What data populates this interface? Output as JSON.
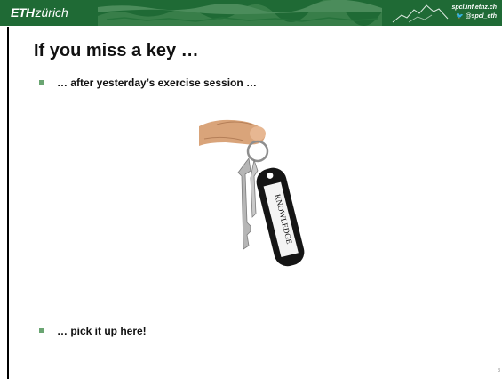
{
  "header": {
    "logo_eth": "ETH",
    "logo_zurich": "zürich",
    "site": "spcl.inf.ethz.ch",
    "twitter": "@spcl_eth",
    "bar_color": "#1f6a35"
  },
  "slide": {
    "title": "If you miss a key …",
    "bullets": [
      "… after yesterday’s exercise session …",
      "… pick it up here!"
    ],
    "keytag_text": "KNOWLEDGE",
    "page_number": "3",
    "bullet_color": "#6aa572"
  }
}
